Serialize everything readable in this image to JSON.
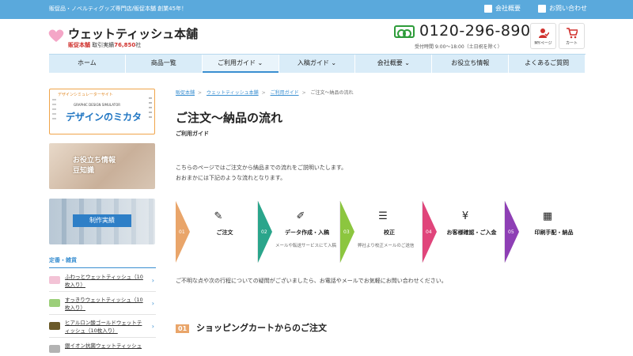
{
  "topbar": {
    "tagline": "販促品・ノベルティグッズ専門店/販促本舗 創業45年！",
    "company_link": "会社概要",
    "contact_link": "お問い合わせ"
  },
  "header": {
    "logo_name": "ウェットティッシュ本舗",
    "logo_brand": "販促本舗",
    "logo_sub": "取引実績",
    "logo_count": "76,850",
    "logo_unit": "社",
    "phone": "0120-296-890",
    "hours": "受付時間 9:00～18:00（土日祝を除く）",
    "mypage": "MYページ",
    "cart": "カート"
  },
  "nav": [
    "ホーム",
    "商品一覧",
    "ご利用ガイド ⌄",
    "入稿ガイド ⌄",
    "会社概要 ⌄",
    "お役立ち情報",
    "よくあるご質問"
  ],
  "sidebar": {
    "banner1_top": "デザインシミュレーターサイト",
    "banner1_mid": "GRAPHIC DESIGN SIMULATOR",
    "banner1_main": "デザインのミカタ",
    "banner2_l1": "お役立ち情報",
    "banner2_l2": "豆知識",
    "banner3": "制作実績",
    "section_title": "定番・雑貨",
    "products": [
      "ふわっとウェットティッシュ（10枚入り）",
      "すっきりウェットティッシュ（10枚入り）",
      "ヒアルロン酸ゴールドウェットティッシュ（10枚入り）",
      "銀イオン抗菌ウェットティッシュ"
    ]
  },
  "main": {
    "breadcrumb": [
      "販促本舗",
      "ウェットティッシュ本舗",
      "ご利用ガイド",
      "ご注文～納品の流れ"
    ],
    "title": "ご注文～納品の流れ",
    "subtitle": "ご利用ガイド",
    "intro_l1": "こちらのページではご注文から納品までの流れをご説明いたします。",
    "intro_l2": "おおまかには下記のような流れとなります。",
    "steps": [
      {
        "num": "01",
        "title": "ご注文",
        "desc": "",
        "color": "#e9a56a",
        "icon": "✎"
      },
      {
        "num": "02",
        "title": "データ作成・入稿",
        "desc": "メールや転送サービスにて入稿",
        "color": "#2aa58b",
        "icon": "✐"
      },
      {
        "num": "03",
        "title": "校正",
        "desc": "弊社より校正メールのご送信",
        "color": "#8cc63f",
        "icon": "☰"
      },
      {
        "num": "04",
        "title": "お客様確認・ご入金",
        "desc": "",
        "color": "#e0457b",
        "icon": "¥"
      },
      {
        "num": "05",
        "title": "印刷手配・納品",
        "desc": "",
        "color": "#8e3fb5",
        "icon": "▦"
      }
    ],
    "note": "ご不明な点や次の行程についての疑問がございましたら、お電話やメールでお気軽にお問い合わせください。",
    "section_num": "01",
    "section_title": "ショッピングカートからのご注文"
  }
}
